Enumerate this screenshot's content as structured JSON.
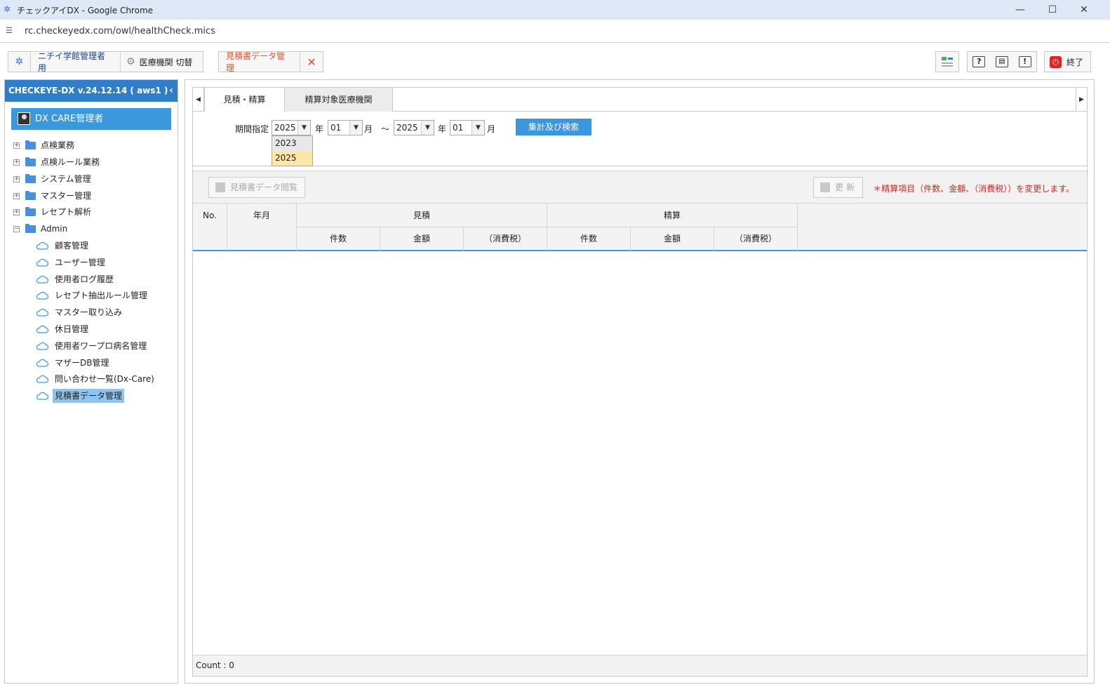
{
  "window": {
    "title": "チェックアイDX - Google Chrome",
    "minimize": "—",
    "maximize": "☐",
    "close": "✕"
  },
  "address_bar": {
    "url": "rc.checkeyedx.com/owl/healthCheck.mics"
  },
  "app_toolbar": {
    "user_label": "ニチイ学館管理者用",
    "switch_label": "医療機関 切替",
    "current_screen": "見積書データ管理",
    "exit_label": "終了"
  },
  "sidebar": {
    "header": "CHECKEYE-DX v.24.12.14 ( aws1 )",
    "collapse": "‹",
    "user": "DX CARE管理者",
    "folders": [
      {
        "label": "点検業務",
        "expander": "+"
      },
      {
        "label": "点検ルール業務",
        "expander": "+"
      },
      {
        "label": "システム管理",
        "expander": "+"
      },
      {
        "label": "マスター管理",
        "expander": "+"
      },
      {
        "label": "レセプト解析",
        "expander": "+"
      },
      {
        "label": "Admin",
        "expander": "−"
      }
    ],
    "admin_items": [
      {
        "label": "顧客管理"
      },
      {
        "label": "ユーザー管理"
      },
      {
        "label": "使用者ログ履歴"
      },
      {
        "label": "レセプト抽出ルール管理"
      },
      {
        "label": "マスター取り込み"
      },
      {
        "label": "休日管理"
      },
      {
        "label": "使用者ワープロ病名管理"
      },
      {
        "label": "マザーDB管理"
      },
      {
        "label": "問い合わせ一覧(Dx-Care)"
      },
      {
        "label": "見積書データ管理"
      }
    ]
  },
  "tabs": {
    "left_arrow": "◀",
    "right_arrow": "▶",
    "items": [
      {
        "label": "見積・精算"
      },
      {
        "label": "精算対象医療機関"
      }
    ]
  },
  "filter": {
    "period_label": "期間指定",
    "from_year": "2025",
    "from_month": "01",
    "to_year": "2025",
    "to_month": "01",
    "year_unit": "年",
    "month_unit": "月",
    "tilde": "～",
    "search_button": "集計及び検索",
    "year_options": [
      "2023",
      "2025"
    ]
  },
  "toolbar2": {
    "view_button": "見積書データ閲覧",
    "update_button": "更 新",
    "notice": "＊精算項目（件数、金額、（消費税））を変更します。"
  },
  "grid": {
    "col_no": "No.",
    "col_month": "年月",
    "group_estimate": "見積",
    "group_settlement": "精算",
    "sub_count": "件数",
    "sub_amount": "金額",
    "sub_tax": "（消費税）",
    "rows": []
  },
  "footer": {
    "count": "Count : 0"
  },
  "colors": {
    "accent": "#3d97dd",
    "header_blue": "#2f7fc6",
    "notice_red": "#d22222",
    "highlight": "#fde7a5"
  }
}
